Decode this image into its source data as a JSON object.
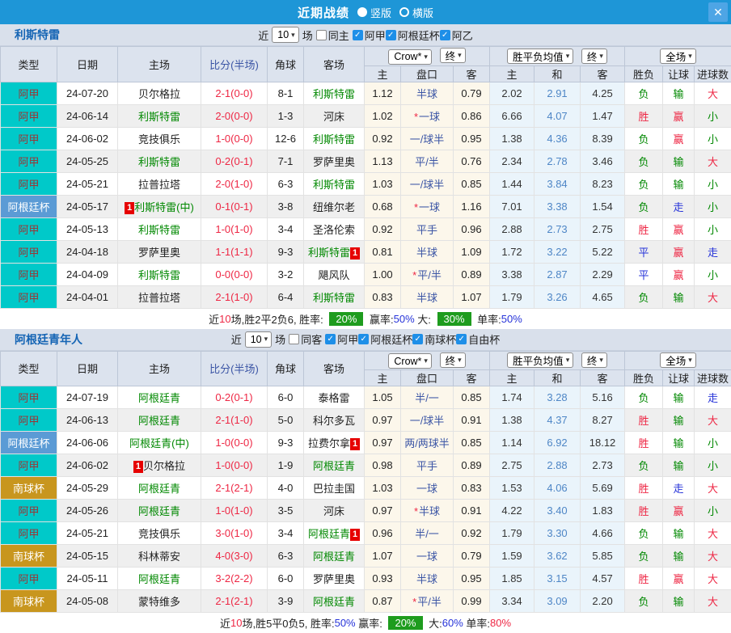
{
  "titlebar": {
    "title": "近期战绩",
    "vertical_label": "竖版",
    "horizontal_label": "横版",
    "close_icon": "✕"
  },
  "controls": {
    "bookmaker": "Crow*",
    "final": "终",
    "avg": "胜平负均值",
    "scope": "全场",
    "caret": "▾"
  },
  "columns": {
    "type": "类型",
    "date": "日期",
    "home": "主场",
    "score": "比分(半场)",
    "corner": "角球",
    "away": "客场",
    "odds_home": "主",
    "handicap": "盘口",
    "odds_away": "客",
    "avg_home": "主",
    "avg_draw": "和",
    "avg_away": "客",
    "wdl": "胜负",
    "let": "让球",
    "goals": "进球数"
  },
  "misc": {
    "card": "1",
    "check": "✓"
  },
  "colors": {
    "topbar_bg": "#1E96D7",
    "close_bg": "#4EA5E5",
    "section_header_bg": "#D9E0EB",
    "table_header_bg": "#DCE3EE",
    "red": "#EE2744",
    "green": "#008800",
    "blue": "#2633D9",
    "badge_bg": "#1E9C1E",
    "handicap_text": "#3B55A5",
    "avg_draw_text": "#4E86C6",
    "odds_col_bg": "#FCF7EB",
    "avg_col_bg": "#EAF4FB",
    "alt_row_bg": "#EFEFEF",
    "card_bg": "#E60000",
    "team_link": "#1464B4"
  },
  "league_styles": {
    "阿甲": {
      "bg": "#00C9C9",
      "fg": "#9C3535"
    },
    "阿根廷杯": {
      "bg": "#5B9BD5",
      "fg": "#FFFFFF"
    },
    "南球杯": {
      "bg": "#C8961E",
      "fg": "#FFFFFF"
    }
  },
  "result_colors": {
    "胜": "red",
    "平": "blue",
    "负": "green",
    "赢": "red",
    "走": "blue",
    "输": "green",
    "大": "red",
    "小": "green"
  },
  "sections": [
    {
      "team": "利斯特雷",
      "filters": {
        "near": "近",
        "games": "10",
        "suffix": "场",
        "same_label": "同主",
        "same_checked": false,
        "leagues": [
          "阿甲",
          "阿根廷杯",
          "阿乙"
        ]
      },
      "rows": [
        {
          "league": "阿甲",
          "date": "24-07-20",
          "home": "贝尔格拉",
          "hg": false,
          "hc": false,
          "score": "2-1",
          "half": "(0-0)",
          "corner": "8-1",
          "away": "利斯特雷",
          "ag": true,
          "ac": false,
          "o1": "1.12",
          "star": false,
          "hcap": "半球",
          "o2": "0.79",
          "a1": "2.02",
          "a2": "2.91",
          "a3": "4.25",
          "r1": "负",
          "r2": "输",
          "r3": "大"
        },
        {
          "league": "阿甲",
          "date": "24-06-14",
          "home": "利斯特雷",
          "hg": true,
          "hc": false,
          "score": "2-0",
          "half": "(0-0)",
          "corner": "1-3",
          "away": "河床",
          "ag": false,
          "ac": false,
          "o1": "1.02",
          "star": true,
          "hcap": "一球",
          "o2": "0.86",
          "a1": "6.66",
          "a2": "4.07",
          "a3": "1.47",
          "r1": "胜",
          "r2": "赢",
          "r3": "小"
        },
        {
          "league": "阿甲",
          "date": "24-06-02",
          "home": "竞技俱乐",
          "hg": false,
          "hc": false,
          "score": "1-0",
          "half": "(0-0)",
          "corner": "12-6",
          "away": "利斯特雷",
          "ag": true,
          "ac": false,
          "o1": "0.92",
          "star": false,
          "hcap": "一/球半",
          "o2": "0.95",
          "a1": "1.38",
          "a2": "4.36",
          "a3": "8.39",
          "r1": "负",
          "r2": "赢",
          "r3": "小"
        },
        {
          "league": "阿甲",
          "date": "24-05-25",
          "home": "利斯特雷",
          "hg": true,
          "hc": false,
          "score": "0-2",
          "half": "(0-1)",
          "corner": "7-1",
          "away": "罗萨里奥",
          "ag": false,
          "ac": false,
          "o1": "1.13",
          "star": false,
          "hcap": "平/半",
          "o2": "0.76",
          "a1": "2.34",
          "a2": "2.78",
          "a3": "3.46",
          "r1": "负",
          "r2": "输",
          "r3": "大"
        },
        {
          "league": "阿甲",
          "date": "24-05-21",
          "home": "拉普拉塔",
          "hg": false,
          "hc": false,
          "score": "2-0",
          "half": "(1-0)",
          "corner": "6-3",
          "away": "利斯特雷",
          "ag": true,
          "ac": false,
          "o1": "1.03",
          "star": false,
          "hcap": "一/球半",
          "o2": "0.85",
          "a1": "1.44",
          "a2": "3.84",
          "a3": "8.23",
          "r1": "负",
          "r2": "输",
          "r3": "小"
        },
        {
          "league": "阿根廷杯",
          "date": "24-05-17",
          "home": "利斯特雷(中)",
          "hg": true,
          "hc": true,
          "score": "0-1",
          "half": "(0-1)",
          "corner": "3-8",
          "away": "纽维尔老",
          "ag": false,
          "ac": false,
          "o1": "0.68",
          "star": true,
          "hcap": "一球",
          "o2": "1.16",
          "a1": "7.01",
          "a2": "3.38",
          "a3": "1.54",
          "r1": "负",
          "r2": "走",
          "r3": "小"
        },
        {
          "league": "阿甲",
          "date": "24-05-13",
          "home": "利斯特雷",
          "hg": true,
          "hc": false,
          "score": "1-0",
          "half": "(1-0)",
          "corner": "3-4",
          "away": "圣洛伦索",
          "ag": false,
          "ac": false,
          "o1": "0.92",
          "star": false,
          "hcap": "平手",
          "o2": "0.96",
          "a1": "2.88",
          "a2": "2.73",
          "a3": "2.75",
          "r1": "胜",
          "r2": "赢",
          "r3": "小"
        },
        {
          "league": "阿甲",
          "date": "24-04-18",
          "home": "罗萨里奥",
          "hg": false,
          "hc": false,
          "score": "1-1",
          "half": "(1-1)",
          "corner": "9-3",
          "away": "利斯特雷",
          "ag": true,
          "ac": true,
          "o1": "0.81",
          "star": false,
          "hcap": "半球",
          "o2": "1.09",
          "a1": "1.72",
          "a2": "3.22",
          "a3": "5.22",
          "r1": "平",
          "r2": "赢",
          "r3": "走"
        },
        {
          "league": "阿甲",
          "date": "24-04-09",
          "home": "利斯特雷",
          "hg": true,
          "hc": false,
          "score": "0-0",
          "half": "(0-0)",
          "corner": "3-2",
          "away": "飓风队",
          "ag": false,
          "ac": false,
          "o1": "1.00",
          "star": true,
          "hcap": "平/半",
          "o2": "0.89",
          "a1": "3.38",
          "a2": "2.87",
          "a3": "2.29",
          "r1": "平",
          "r2": "赢",
          "r3": "小"
        },
        {
          "league": "阿甲",
          "date": "24-04-01",
          "home": "拉普拉塔",
          "hg": false,
          "hc": false,
          "score": "2-1",
          "half": "(1-0)",
          "corner": "6-4",
          "away": "利斯特雷",
          "ag": true,
          "ac": false,
          "o1": "0.83",
          "star": false,
          "hcap": "半球",
          "o2": "1.07",
          "a1": "1.79",
          "a2": "3.26",
          "a3": "4.65",
          "r1": "负",
          "r2": "输",
          "r3": "大"
        }
      ],
      "summary": [
        {
          "text": "近",
          "style": "plain"
        },
        {
          "text": "10",
          "style": "red"
        },
        {
          "text": "场,胜2平2负6, 胜率: ",
          "style": "plain"
        },
        {
          "text": "20%",
          "style": "badge"
        },
        {
          "text": " 赢率:",
          "style": "plain"
        },
        {
          "text": "50%",
          "style": "blue"
        },
        {
          "text": " 大: ",
          "style": "plain"
        },
        {
          "text": "30%",
          "style": "badge"
        },
        {
          "text": " 单率:",
          "style": "plain"
        },
        {
          "text": "50%",
          "style": "blue"
        }
      ]
    },
    {
      "team": "阿根廷青年人",
      "filters": {
        "near": "近",
        "games": "10",
        "suffix": "场",
        "same_label": "同客",
        "same_checked": false,
        "leagues": [
          "阿甲",
          "阿根廷杯",
          "南球杯",
          "自由杯"
        ]
      },
      "rows": [
        {
          "league": "阿甲",
          "date": "24-07-19",
          "home": "阿根廷青",
          "hg": true,
          "hc": false,
          "score": "0-2",
          "half": "(0-1)",
          "corner": "6-0",
          "away": "泰格雷",
          "ag": false,
          "ac": false,
          "o1": "1.05",
          "star": false,
          "hcap": "半/一",
          "o2": "0.85",
          "a1": "1.74",
          "a2": "3.28",
          "a3": "5.16",
          "r1": "负",
          "r2": "输",
          "r3": "走"
        },
        {
          "league": "阿甲",
          "date": "24-06-13",
          "home": "阿根廷青",
          "hg": true,
          "hc": false,
          "score": "2-1",
          "half": "(1-0)",
          "corner": "5-0",
          "away": "科尔多瓦",
          "ag": false,
          "ac": false,
          "o1": "0.97",
          "star": false,
          "hcap": "一/球半",
          "o2": "0.91",
          "a1": "1.38",
          "a2": "4.37",
          "a3": "8.27",
          "r1": "胜",
          "r2": "输",
          "r3": "大"
        },
        {
          "league": "阿根廷杯",
          "date": "24-06-06",
          "home": "阿根廷青(中)",
          "hg": true,
          "hc": false,
          "score": "1-0",
          "half": "(0-0)",
          "corner": "9-3",
          "away": "拉费尔拿",
          "ag": false,
          "ac": true,
          "o1": "0.97",
          "star": false,
          "hcap": "两/两球半",
          "o2": "0.85",
          "a1": "1.14",
          "a2": "6.92",
          "a3": "18.12",
          "r1": "胜",
          "r2": "输",
          "r3": "小"
        },
        {
          "league": "阿甲",
          "date": "24-06-02",
          "home": "贝尔格拉",
          "hg": false,
          "hc": true,
          "score": "1-0",
          "half": "(0-0)",
          "corner": "1-9",
          "away": "阿根廷青",
          "ag": true,
          "ac": false,
          "o1": "0.98",
          "star": false,
          "hcap": "平手",
          "o2": "0.89",
          "a1": "2.75",
          "a2": "2.88",
          "a3": "2.73",
          "r1": "负",
          "r2": "输",
          "r3": "小"
        },
        {
          "league": "南球杯",
          "date": "24-05-29",
          "home": "阿根廷青",
          "hg": true,
          "hc": false,
          "score": "2-1",
          "half": "(2-1)",
          "corner": "4-0",
          "away": "巴拉圭国",
          "ag": false,
          "ac": false,
          "o1": "1.03",
          "star": false,
          "hcap": "一球",
          "o2": "0.83",
          "a1": "1.53",
          "a2": "4.06",
          "a3": "5.69",
          "r1": "胜",
          "r2": "走",
          "r3": "大"
        },
        {
          "league": "阿甲",
          "date": "24-05-26",
          "home": "阿根廷青",
          "hg": true,
          "hc": false,
          "score": "1-0",
          "half": "(1-0)",
          "corner": "3-5",
          "away": "河床",
          "ag": false,
          "ac": false,
          "o1": "0.97",
          "star": true,
          "hcap": "半球",
          "o2": "0.91",
          "a1": "4.22",
          "a2": "3.40",
          "a3": "1.83",
          "r1": "胜",
          "r2": "赢",
          "r3": "小"
        },
        {
          "league": "阿甲",
          "date": "24-05-21",
          "home": "竞技俱乐",
          "hg": false,
          "hc": false,
          "score": "3-0",
          "half": "(1-0)",
          "corner": "3-4",
          "away": "阿根廷青",
          "ag": true,
          "ac": true,
          "o1": "0.96",
          "star": false,
          "hcap": "半/一",
          "o2": "0.92",
          "a1": "1.79",
          "a2": "3.30",
          "a3": "4.66",
          "r1": "负",
          "r2": "输",
          "r3": "大"
        },
        {
          "league": "南球杯",
          "date": "24-05-15",
          "home": "科林蒂安",
          "hg": false,
          "hc": false,
          "score": "4-0",
          "half": "(3-0)",
          "corner": "6-3",
          "away": "阿根廷青",
          "ag": true,
          "ac": false,
          "o1": "1.07",
          "star": false,
          "hcap": "一球",
          "o2": "0.79",
          "a1": "1.59",
          "a2": "3.62",
          "a3": "5.85",
          "r1": "负",
          "r2": "输",
          "r3": "大"
        },
        {
          "league": "阿甲",
          "date": "24-05-11",
          "home": "阿根廷青",
          "hg": true,
          "hc": false,
          "score": "3-2",
          "half": "(2-2)",
          "corner": "6-0",
          "away": "罗萨里奥",
          "ag": false,
          "ac": false,
          "o1": "0.93",
          "star": false,
          "hcap": "半球",
          "o2": "0.95",
          "a1": "1.85",
          "a2": "3.15",
          "a3": "4.57",
          "r1": "胜",
          "r2": "赢",
          "r3": "大"
        },
        {
          "league": "南球杯",
          "date": "24-05-08",
          "home": "蒙特维多",
          "hg": false,
          "hc": false,
          "score": "2-1",
          "half": "(2-1)",
          "corner": "3-9",
          "away": "阿根廷青",
          "ag": true,
          "ac": false,
          "o1": "0.87",
          "star": true,
          "hcap": "平/半",
          "o2": "0.99",
          "a1": "3.34",
          "a2": "3.09",
          "a3": "2.20",
          "r1": "负",
          "r2": "输",
          "r3": "大"
        }
      ],
      "summary": [
        {
          "text": "近",
          "style": "plain"
        },
        {
          "text": "10",
          "style": "red"
        },
        {
          "text": "场,胜5平0负5, 胜率:",
          "style": "plain"
        },
        {
          "text": "50%",
          "style": "blue"
        },
        {
          "text": " 赢率: ",
          "style": "plain"
        },
        {
          "text": "20%",
          "style": "badge"
        },
        {
          "text": " 大:",
          "style": "plain"
        },
        {
          "text": "60%",
          "style": "blue"
        },
        {
          "text": " 单率:",
          "style": "plain"
        },
        {
          "text": "80%",
          "style": "red"
        }
      ]
    }
  ]
}
